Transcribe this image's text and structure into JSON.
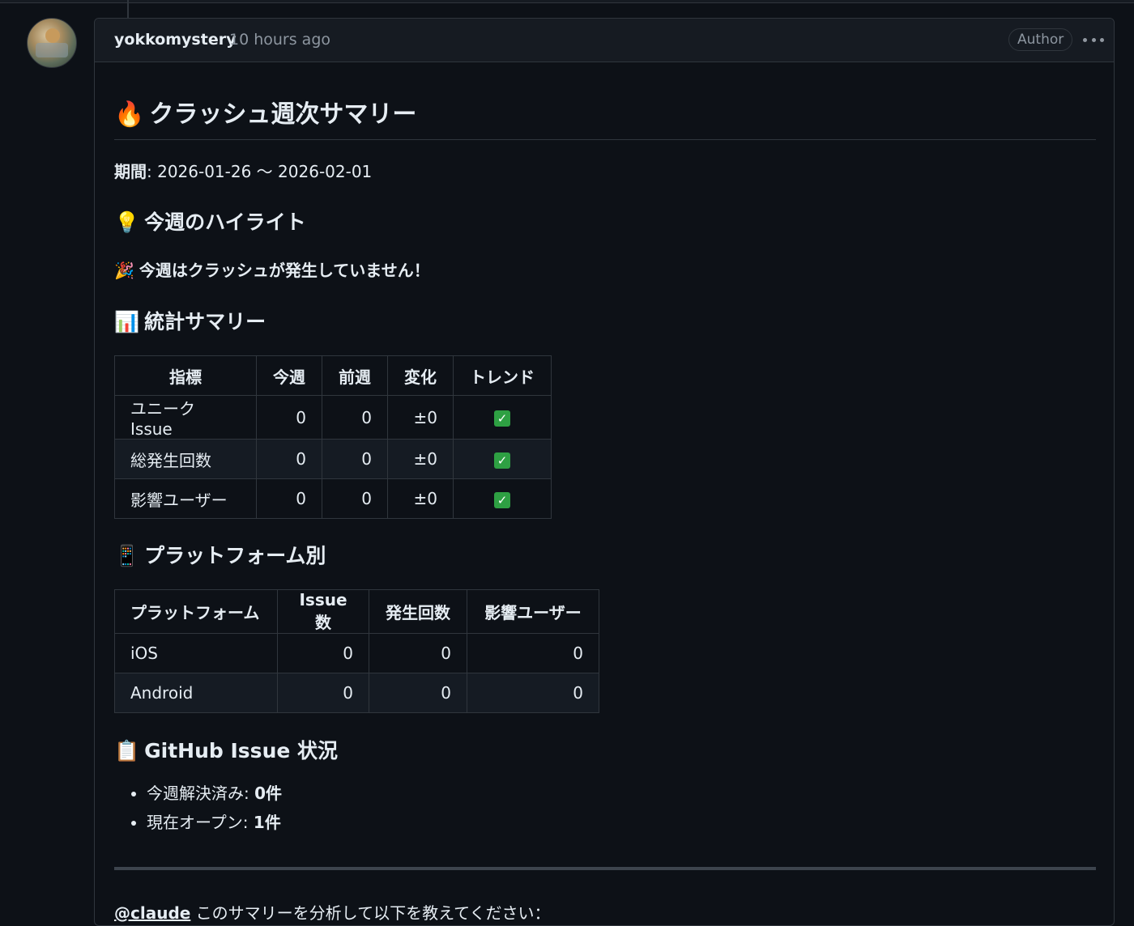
{
  "comment": {
    "author": "yokkomystery",
    "timestamp": "10 hours ago",
    "badge": "Author"
  },
  "body": {
    "title_emoji": "🔥",
    "title": "クラッシュ週次サマリー",
    "period_label": "期間",
    "period_value": ": 2026-01-26 〜 2026-02-01",
    "highlight": {
      "emoji": "💡",
      "heading": "今週のハイライト"
    },
    "note": {
      "emoji": "🎉",
      "text": "今週はクラッシュが発生していません！"
    },
    "stats": {
      "emoji": "📊",
      "heading": "統計サマリー",
      "columns": [
        "指標",
        "今週",
        "前週",
        "変化",
        "トレンド"
      ],
      "rows": [
        {
          "metric": "ユニーク Issue",
          "this_week": "0",
          "last_week": "0",
          "change": "±0",
          "trend": "✓"
        },
        {
          "metric": "総発生回数",
          "this_week": "0",
          "last_week": "0",
          "change": "±0",
          "trend": "✓"
        },
        {
          "metric": "影響ユーザー",
          "this_week": "0",
          "last_week": "0",
          "change": "±0",
          "trend": "✓"
        }
      ]
    },
    "platform": {
      "emoji": "📱",
      "heading": "プラットフォーム別",
      "columns": [
        "プラットフォーム",
        "Issue数",
        "発生回数",
        "影響ユーザー"
      ],
      "rows": [
        {
          "name": "iOS",
          "issues": "0",
          "occurrences": "0",
          "users": "0"
        },
        {
          "name": "Android",
          "issues": "0",
          "occurrences": "0",
          "users": "0"
        }
      ]
    },
    "github": {
      "emoji": "📋",
      "heading": "GitHub Issue 状況",
      "items": [
        {
          "label": "今週解決済み: ",
          "value": "0件"
        },
        {
          "label": "現在オープン: ",
          "value": "1件"
        }
      ]
    },
    "mention": "@claude",
    "mention_text": " このサマリーを分析して以下を教えてください："
  }
}
